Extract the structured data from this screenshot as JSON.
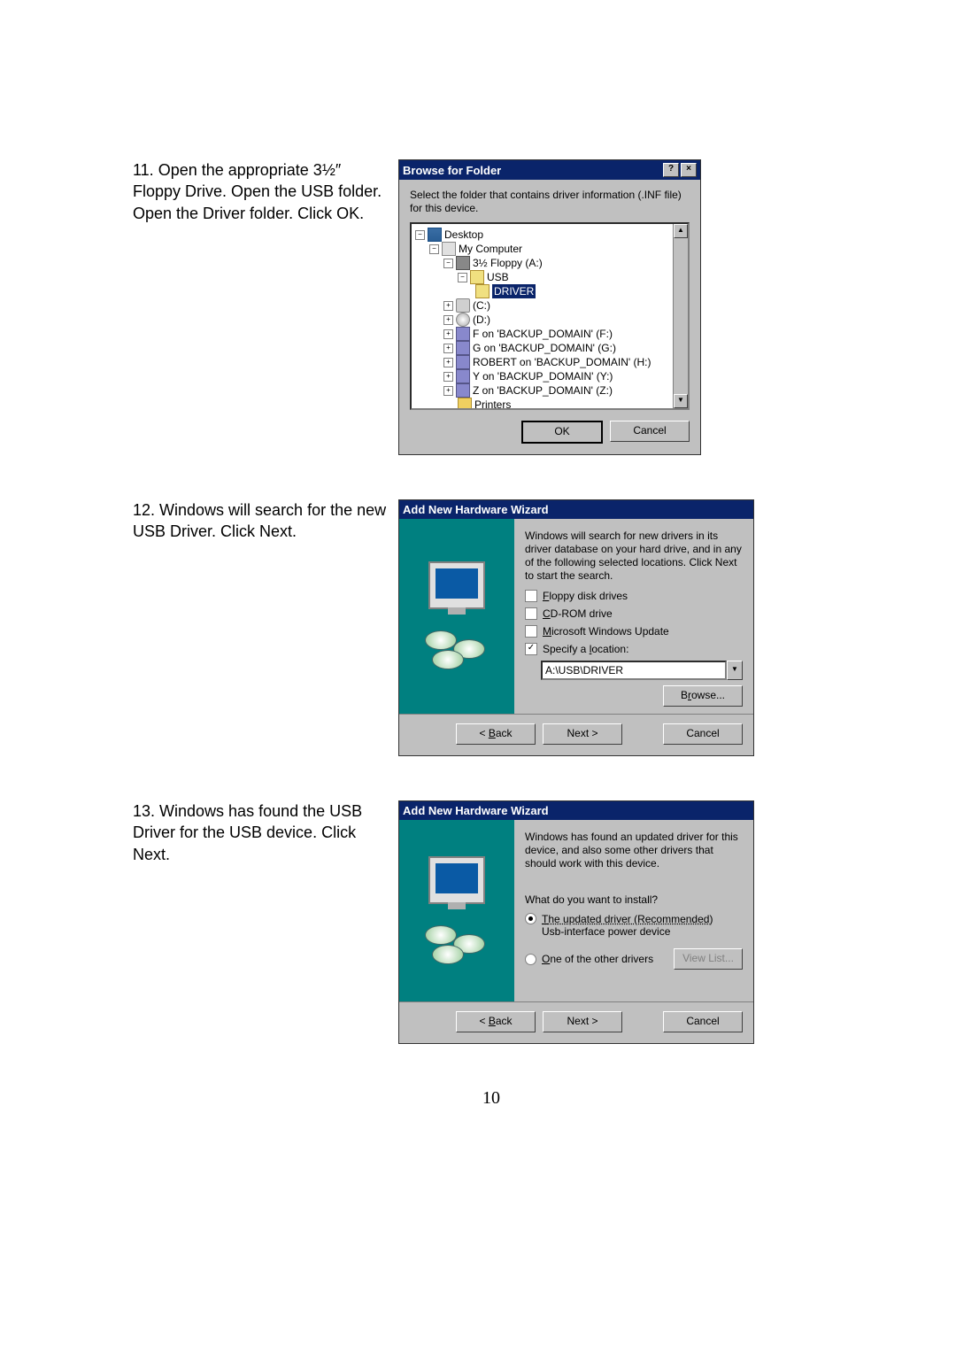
{
  "steps": {
    "s11": "11. Open the appropriate 3½″ Floppy Drive.  Open the USB folder.  Open the Driver folder.  Click OK.",
    "s12": "12.  Windows will search for the new USB Driver.  Click Next.",
    "s13": "13. Windows has found the USB Driver for the USB device.  Click Next."
  },
  "browse": {
    "title": "Browse for Folder",
    "help": "?",
    "close": "×",
    "prompt": "Select the folder that contains driver information (.INF file) for this device.",
    "tree": {
      "desktop": "Desktop",
      "mycomputer": "My Computer",
      "floppy": "3½ Floppy (A:)",
      "usb": "USB",
      "driver": "DRIVER",
      "c": "(C:)",
      "d": "(D:)",
      "f": "F on 'BACKUP_DOMAIN' (F:)",
      "g": "G on 'BACKUP_DOMAIN' (G:)",
      "h": "ROBERT on 'BACKUP_DOMAIN' (H:)",
      "y": "Y on 'BACKUP_DOMAIN' (Y:)",
      "z": "Z on 'BACKUP_DOMAIN' (Z:)",
      "printers": "Printers"
    },
    "ok": "OK",
    "cancel": "Cancel"
  },
  "wiz1": {
    "title": "Add New Hardware Wizard",
    "desc": "Windows will search for new drivers in its driver database on your hard drive, and in any of the following selected locations. Click Next to start the search.",
    "floppy": "Floppy disk drives",
    "cdrom": "CD-ROM drive",
    "msupdate": "Microsoft Windows Update",
    "specify": "Specify a location:",
    "path": "A:\\USB\\DRIVER",
    "browse": "Browse...",
    "back": "< Back",
    "next": "Next >",
    "cancel": "Cancel"
  },
  "wiz2": {
    "title": "Add New Hardware Wizard",
    "desc": "Windows has found an updated driver for this device, and also some other drivers that should work with this device.",
    "question": "What do you want to install?",
    "opt1": "The updated driver (Recommended)",
    "opt1sub": "Usb-interface power device",
    "opt2": "One of the other drivers",
    "viewlist": "View List...",
    "back": "< Back",
    "next": "Next >",
    "cancel": "Cancel"
  },
  "pagenum": "10"
}
